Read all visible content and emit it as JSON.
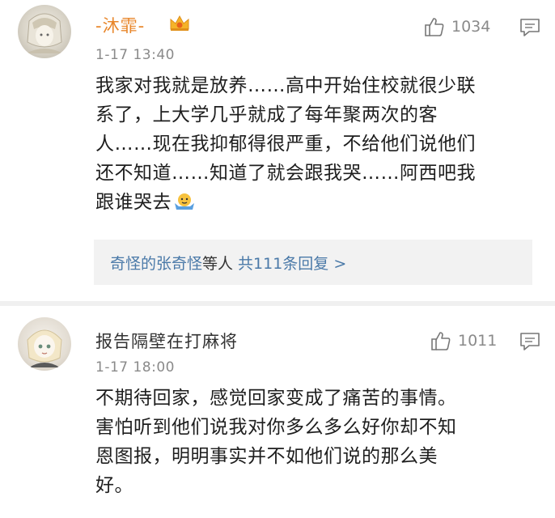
{
  "comments": [
    {
      "username": "-沐霏-",
      "timestamp": "1-17 13:40",
      "likes": "1034",
      "text": "我家对我就是放养……高中开始住校就很少联\n系了，上大学几乎就成了每年聚两次的客\n人……现在我抑郁得很严重，不给他们说他们\n还不知道……知道了就会跟我哭……阿西吧我\n跟谁哭去",
      "reply_summary": {
        "names": "奇怪的张奇怪",
        "suffix": "等人",
        "total": "共111条回复 >"
      }
    },
    {
      "username": "报告隔壁在打麻将",
      "timestamp": "1-17 18:00",
      "likes": "1011",
      "text": "不期待回家，感觉回家变成了痛苦的事情。\n害怕听到他们说我对你多么多么好你却不知\n恩图报，明明事实并不如他们说的那么美\n好。"
    }
  ],
  "colors": {
    "vip_name": "#e8862a",
    "link": "#4a79a8",
    "meta": "#8a8a8a",
    "reply_bg": "#f2f2f2"
  },
  "icons": [
    "crown-icon",
    "thumbs-up-icon",
    "reply-icon",
    "shrug-emoji-icon"
  ]
}
